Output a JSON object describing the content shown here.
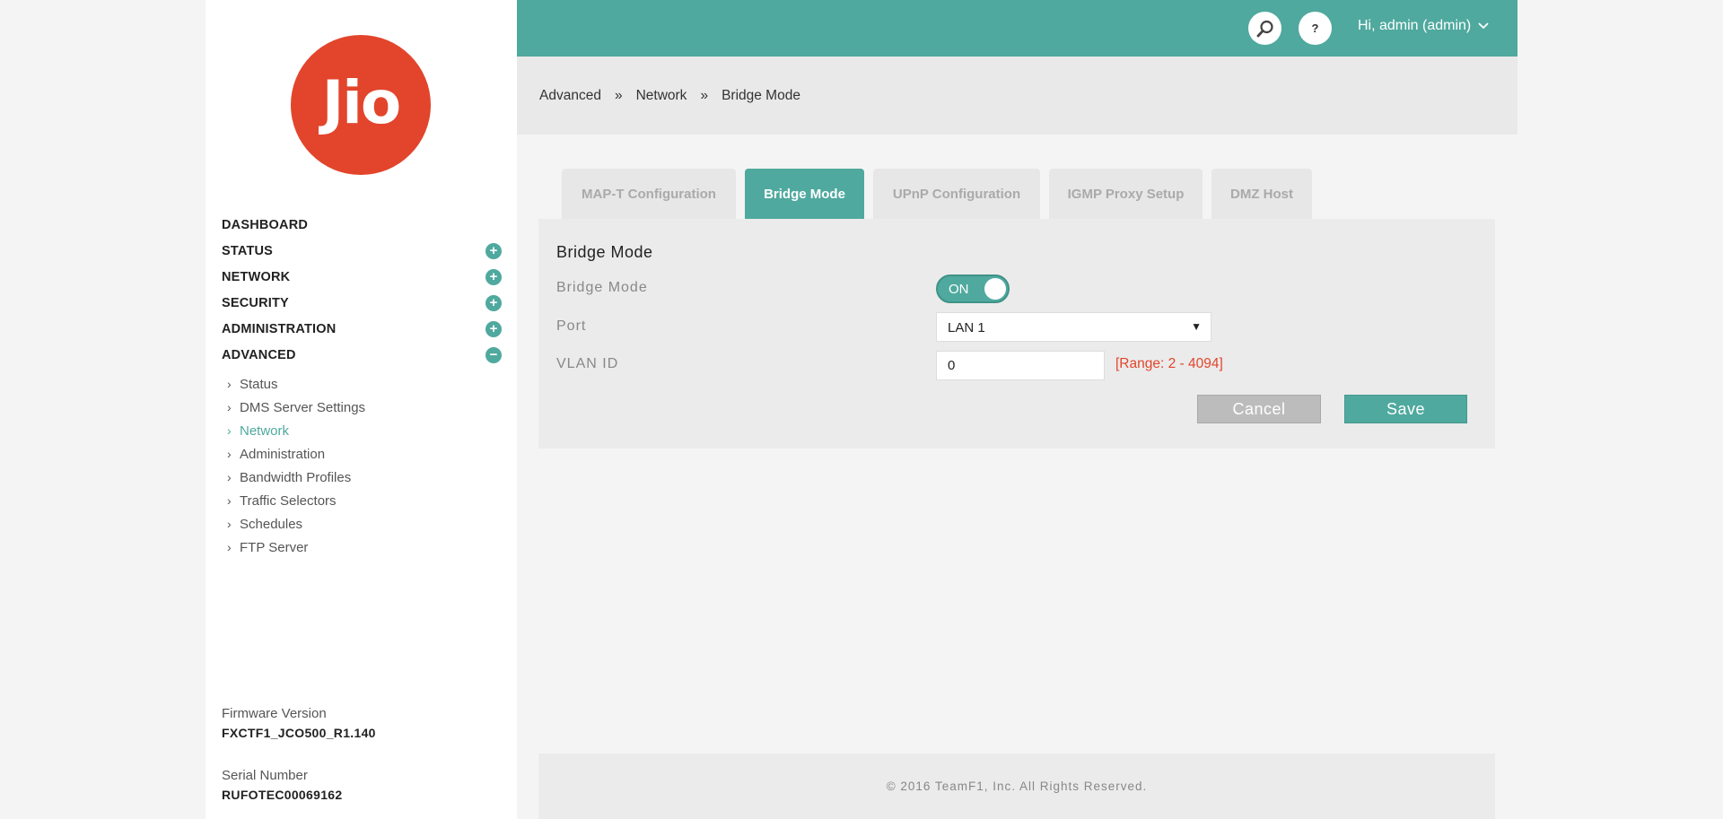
{
  "logo": {
    "text": "Jio",
    "color": "#e2452c"
  },
  "accent_color": "#4fa99e",
  "nav": [
    {
      "label": "DASHBOARD",
      "toggle": null
    },
    {
      "label": "STATUS",
      "toggle": "+"
    },
    {
      "label": "NETWORK",
      "toggle": "+"
    },
    {
      "label": "SECURITY",
      "toggle": "+"
    },
    {
      "label": "ADMINISTRATION",
      "toggle": "+"
    },
    {
      "label": "ADVANCED",
      "toggle": "−"
    }
  ],
  "subnav": [
    "Status",
    "DMS Server Settings",
    "Network",
    "Administration",
    "Bandwidth Profiles",
    "Traffic Selectors",
    "Schedules",
    "FTP Server"
  ],
  "subnav_active": "Network",
  "firmware": {
    "label": "Firmware Version",
    "value": "FXCTF1_JCO500_R1.140"
  },
  "serial": {
    "label": "Serial Number",
    "value": "RUFOTEC00069162"
  },
  "header": {
    "user": "Hi, admin (admin)",
    "help": "?"
  },
  "breadcrumbs": [
    "Advanced",
    "Network",
    "Bridge Mode"
  ],
  "breadcrumb_sep": "»",
  "tabs": [
    {
      "label": "MAP-T Configuration",
      "active": false
    },
    {
      "label": "Bridge Mode",
      "active": true
    },
    {
      "label": "UPnP Configuration",
      "active": false
    },
    {
      "label": "IGMP Proxy Setup",
      "active": false
    },
    {
      "label": "DMZ Host",
      "active": false
    }
  ],
  "panel": {
    "title": "Bridge Mode",
    "bridge_label": "Bridge Mode",
    "bridge_state": "ON",
    "port_label": "Port",
    "port_value": "LAN 1",
    "vlan_label": "VLAN ID",
    "vlan_value": "0",
    "vlan_range": "[Range: 2 - 4094]",
    "cancel": "Cancel",
    "save": "Save"
  },
  "footer": "© 2016 TeamF1, Inc. All Rights Reserved."
}
